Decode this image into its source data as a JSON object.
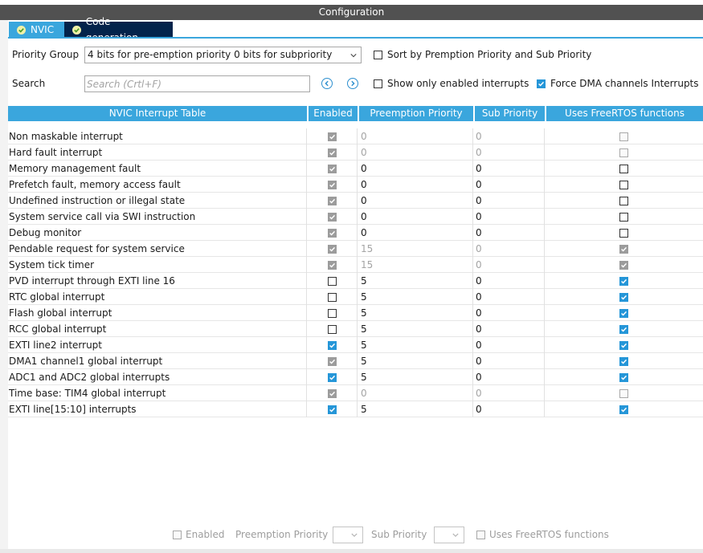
{
  "window": {
    "title": "Configuration"
  },
  "tabs": [
    {
      "label": "NVIC",
      "active": true
    },
    {
      "label": "Code generation",
      "active": false
    }
  ],
  "priority_group": {
    "label": "Priority Group",
    "value": "4 bits for pre-emption priority 0 bits for subpriority"
  },
  "search": {
    "label": "Search",
    "placeholder": "Search (Crtl+F)"
  },
  "options": {
    "sort_label": "Sort by Premption Priority and Sub Priority",
    "sort_checked": false,
    "enabled_only_label": "Show only enabled interrupts",
    "enabled_only_checked": false,
    "force_dma_label": "Force DMA channels Interrupts",
    "force_dma_checked": true
  },
  "table": {
    "headers": [
      "NVIC Interrupt Table",
      "Enabled",
      "Preemption Priority",
      "Sub Priority",
      "Uses FreeRTOS functions"
    ],
    "rows": [
      {
        "name": "Non maskable interrupt",
        "enabled": "locked-on",
        "preempt": "0",
        "sub": "0",
        "dim": true,
        "freertos": "disabled"
      },
      {
        "name": "Hard fault interrupt",
        "enabled": "locked-on",
        "preempt": "0",
        "sub": "0",
        "dim": true,
        "freertos": "disabled"
      },
      {
        "name": "Memory management fault",
        "enabled": "locked-on",
        "preempt": "0",
        "sub": "0",
        "dim": false,
        "freertos": "off"
      },
      {
        "name": "Prefetch fault, memory access fault",
        "enabled": "locked-on",
        "preempt": "0",
        "sub": "0",
        "dim": false,
        "freertos": "off"
      },
      {
        "name": "Undefined instruction or illegal state",
        "enabled": "locked-on",
        "preempt": "0",
        "sub": "0",
        "dim": false,
        "freertos": "off"
      },
      {
        "name": "System service call via SWI instruction",
        "enabled": "locked-on",
        "preempt": "0",
        "sub": "0",
        "dim": false,
        "freertos": "off"
      },
      {
        "name": "Debug monitor",
        "enabled": "locked-on",
        "preempt": "0",
        "sub": "0",
        "dim": false,
        "freertos": "off"
      },
      {
        "name": "Pendable request for system service",
        "enabled": "locked-on",
        "preempt": "15",
        "sub": "0",
        "dim": true,
        "freertos": "locked-on"
      },
      {
        "name": "System tick timer",
        "enabled": "locked-on",
        "preempt": "15",
        "sub": "0",
        "dim": true,
        "freertos": "locked-on"
      },
      {
        "name": "PVD interrupt through EXTI line 16",
        "enabled": "off",
        "preempt": "5",
        "sub": "0",
        "dim": false,
        "freertos": "on"
      },
      {
        "name": "RTC global interrupt",
        "enabled": "off",
        "preempt": "5",
        "sub": "0",
        "dim": false,
        "freertos": "on"
      },
      {
        "name": "Flash global interrupt",
        "enabled": "off",
        "preempt": "5",
        "sub": "0",
        "dim": false,
        "freertos": "on"
      },
      {
        "name": "RCC global interrupt",
        "enabled": "off",
        "preempt": "5",
        "sub": "0",
        "dim": false,
        "freertos": "on"
      },
      {
        "name": "EXTI line2 interrupt",
        "enabled": "on",
        "preempt": "5",
        "sub": "0",
        "dim": false,
        "freertos": "on"
      },
      {
        "name": "DMA1 channel1 global interrupt",
        "enabled": "locked-on",
        "preempt": "5",
        "sub": "0",
        "dim": false,
        "freertos": "on"
      },
      {
        "name": "ADC1 and ADC2 global interrupts",
        "enabled": "on",
        "preempt": "5",
        "sub": "0",
        "dim": false,
        "freertos": "on"
      },
      {
        "name": "Time base: TIM4 global interrupt",
        "enabled": "locked-on",
        "preempt": "0",
        "sub": "0",
        "dim": true,
        "freertos": "disabled"
      },
      {
        "name": "EXTI line[15:10] interrupts",
        "enabled": "on",
        "preempt": "5",
        "sub": "0",
        "dim": false,
        "freertos": "on"
      }
    ]
  },
  "footer": {
    "enabled_label": "Enabled",
    "preemption_label": "Preemption Priority",
    "sub_label": "Sub Priority",
    "freertos_label": "Uses FreeRTOS functions"
  },
  "colors": {
    "accent": "#3aa6dd",
    "title_bar": "#515151",
    "inactive_tab": "#03234b",
    "checkbox_blue": "#2596d8",
    "checkbox_gray": "#9c9c9c"
  }
}
